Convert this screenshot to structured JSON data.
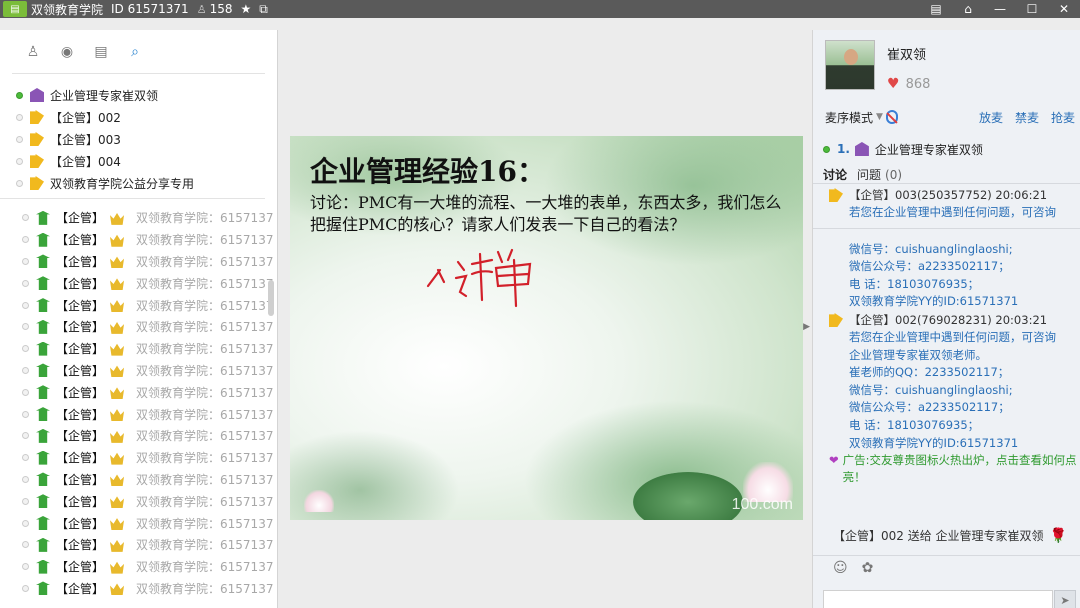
{
  "titlebar": {
    "app_name": "双领教育学院",
    "id_text": "ID 61571371",
    "user_count": "158"
  },
  "left_panel": {
    "toolbar_icons": [
      "members-icon",
      "location-icon",
      "notes-icon",
      "search-icon"
    ],
    "admins": [
      {
        "label": "企业管理专家崔双领",
        "badge": "purple",
        "online": true
      },
      {
        "label": "【企管】002",
        "badge": "yellow",
        "online": false
      },
      {
        "label": "【企管】003",
        "badge": "yellow",
        "online": false
      },
      {
        "label": "【企管】004",
        "badge": "yellow",
        "online": false
      },
      {
        "label": "双领教育学院公益分享专用",
        "badge": "yellow",
        "online": false
      }
    ],
    "member_label": "【企管】",
    "member_id_text": "双领教育学院：6157137",
    "member_count_visible": 18
  },
  "slide": {
    "title": "企业管理经验16：",
    "body": "讨论：PMC有一大堆的流程、一大堆的表单，东西太多，我们怎么把握住PMC的核心？请家人们发表一下自己的看法？",
    "handwriting": "人计单",
    "watermark": "100.com"
  },
  "right_panel": {
    "host_name": "崔双领",
    "likes": "868",
    "mode_label": "麦序模式",
    "links": [
      "放麦",
      "禁麦",
      "抢麦"
    ],
    "queue_number": "1.",
    "queue_name": "企业管理专家崔双领",
    "tabs": {
      "discuss": "讨论",
      "question": "问题",
      "question_count": "(0)"
    },
    "messages": [
      {
        "head": "【企管】003(250357752) 20:06:21",
        "lines": [
          "若您在企业管理中遇到任何问题，可咨询"
        ]
      },
      {
        "head": "",
        "lines": [
          "微信号：cuishuanglinglaoshi;",
          "微信公众号：a2233502117；",
          "电  话：18103076935；",
          "双领教育学院YY的ID:61571371"
        ]
      },
      {
        "head": "【企管】002(769028231) 20:03:21",
        "lines": [
          "若您在企业管理中遇到任何问题，可咨询",
          "企业管理专家崔双领老师。",
          "崔老师的QQ：2233502117；",
          "微信号：cuishuanglinglaoshi;",
          "微信公众号：a2233502117；",
          "电  话：18103076935；",
          "双领教育学院YY的ID:61571371"
        ]
      }
    ],
    "ad_text": "广告:交友尊贵图标火热出炉，点击查看如何点亮！",
    "gift_text": "【企管】002 送给 企业管理专家崔双领"
  }
}
